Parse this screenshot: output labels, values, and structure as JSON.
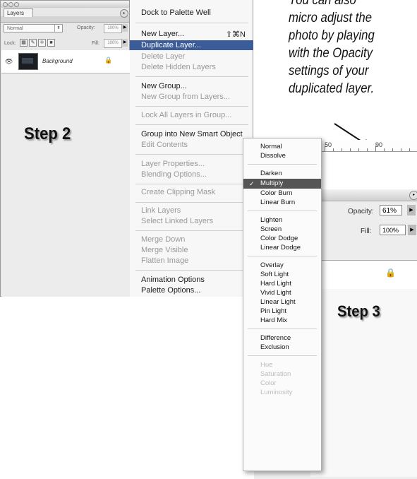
{
  "layers_panel": {
    "tab_label": "Layers",
    "blend_mode": "Normal",
    "opacity_label": "Opacity:",
    "opacity_value": "100%",
    "lock_label": "Lock:",
    "fill_label": "Fill:",
    "fill_value": "100%",
    "layer_name": "Background",
    "icons": [
      "eye-icon",
      "lock-icon",
      "panel-menu-icon"
    ]
  },
  "step2": "Step 2",
  "layer_menu": {
    "items": [
      {
        "label": "Dock to Palette Well",
        "state": "normal"
      },
      {
        "label": "New Layer...",
        "state": "normal",
        "shortcut": "⇧⌘N"
      },
      {
        "label": "Duplicate Layer...",
        "state": "highlighted"
      },
      {
        "label": "Delete Layer",
        "state": "disabled"
      },
      {
        "label": "Delete Hidden Layers",
        "state": "disabled"
      },
      {
        "label": "New Group...",
        "state": "normal"
      },
      {
        "label": "New Group from Layers...",
        "state": "disabled"
      },
      {
        "label": "Lock All Layers in Group...",
        "state": "disabled"
      },
      {
        "label": "Group into New Smart Object",
        "state": "normal"
      },
      {
        "label": "Edit Contents",
        "state": "disabled"
      },
      {
        "label": "Layer Properties...",
        "state": "disabled"
      },
      {
        "label": "Blending Options...",
        "state": "disabled"
      },
      {
        "label": "Create Clipping Mask",
        "state": "disabled"
      },
      {
        "label": "Link Layers",
        "state": "disabled"
      },
      {
        "label": "Select Linked Layers",
        "state": "disabled"
      },
      {
        "label": "Merge Down",
        "state": "disabled"
      },
      {
        "label": "Merge Visible",
        "state": "disabled"
      },
      {
        "label": "Flatten Image",
        "state": "disabled"
      },
      {
        "label": "Animation Options",
        "state": "normal"
      },
      {
        "label": "Palette Options...",
        "state": "normal"
      }
    ]
  },
  "annotation": {
    "lines": [
      "You can also",
      "micro adjust the",
      "photo by playing",
      "with the Opacity",
      "settings of your",
      "duplicated layer."
    ]
  },
  "ruler": {
    "label_1": "50",
    "label_2": "90"
  },
  "step3_panel": {
    "opacity_label": "Opacity:",
    "opacity_value": "61%",
    "fill_label": "Fill:",
    "fill_value": "100%",
    "row_fragment": "r"
  },
  "blend_menu": {
    "items": [
      "Normal",
      "Dissolve",
      "Darken",
      "Multiply",
      "Color Burn",
      "Linear Burn",
      "Lighten",
      "Screen",
      "Color Dodge",
      "Linear Dodge",
      "Overlay",
      "Soft Light",
      "Hard Light",
      "Vivid Light",
      "Linear Light",
      "Pin Light",
      "Hard Mix",
      "Difference",
      "Exclusion",
      "Hue",
      "Saturation",
      "Color",
      "Luminosity"
    ],
    "selected": "Multiply",
    "check_mark": "✓"
  },
  "step3": "Step 3"
}
